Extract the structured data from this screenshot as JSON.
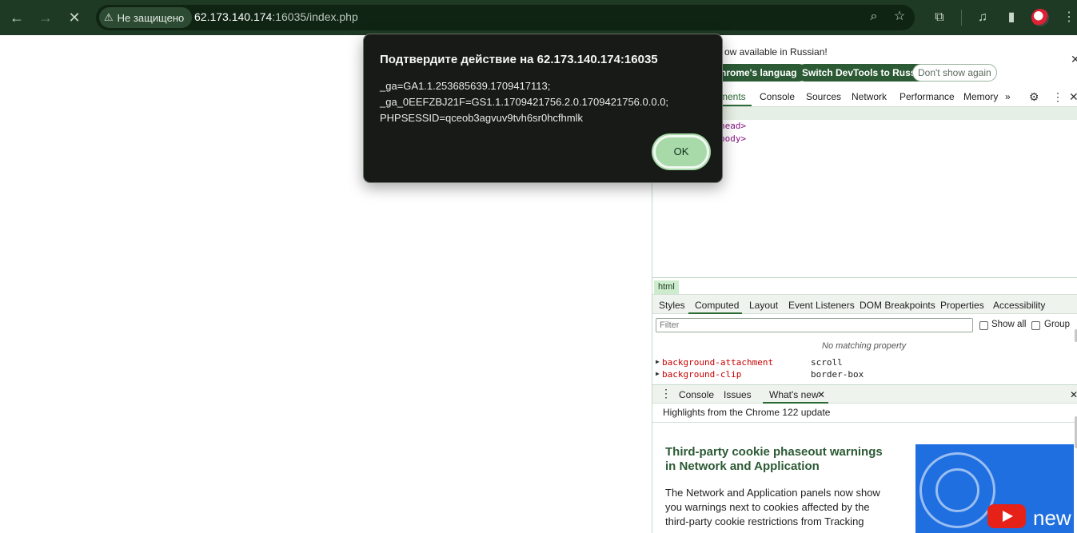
{
  "browser": {
    "security_label": "Не защищено",
    "url_host": "62.173.140.174",
    "url_rest": ":16035/index.php",
    "icons": [
      "back-icon",
      "forward-icon",
      "stop-icon",
      "warning-icon",
      "zoom-icon",
      "bookmark-star-icon",
      "extensions-icon",
      "media-icon",
      "side-panel-icon",
      "avatar",
      "menu-icon"
    ]
  },
  "dialog": {
    "title": "Подтвердите действие на 62.173.140.174:16035",
    "line1": "_ga=GA1.1.253685639.1709417113;",
    "line2": "_ga_0EEFZBJ21F=GS1.1.1709421756.2.0.1709421756.0.0.0;",
    "line3": "PHPSESSID=qceob3agvuv9tvh6sr0hcfhmlk",
    "ok_label": "OK"
  },
  "devtools": {
    "infobar": {
      "text": "ow available in Russian!",
      "btn_language": "hrome's language",
      "btn_switch": "Switch DevTools to Russian",
      "btn_dont_show": "Don't show again"
    },
    "tabs": [
      "ments",
      "Console",
      "Sources",
      "Network",
      "Performance",
      "Memory"
    ],
    "more_tabs": "»",
    "elements": {
      "line1": "head>",
      "line2": "body>"
    },
    "breadcrumb": "html",
    "style_tabs": [
      "Styles",
      "Computed",
      "Layout",
      "Event Listeners",
      "DOM Breakpoints",
      "Properties",
      "Accessibility"
    ],
    "filter_placeholder": "Filter",
    "show_all_label": "Show all",
    "group_label": "Group",
    "no_match": "No matching property",
    "properties": [
      {
        "name": "background-attachment",
        "value": "scroll"
      },
      {
        "name": "background-clip",
        "value": "border-box"
      }
    ],
    "drawer_tabs": [
      "Console",
      "Issues",
      "What's new"
    ],
    "highlights": "Highlights from the Chrome 122 update",
    "whats_new": {
      "title_line1": "Third-party cookie phaseout warnings",
      "title_line2": "in Network and Application",
      "body_line1": "The Network and Application panels now show",
      "body_line2": "you warnings next to cookies affected by the",
      "body_line3": "third-party cookie restrictions from Tracking",
      "image_text": "new"
    }
  }
}
